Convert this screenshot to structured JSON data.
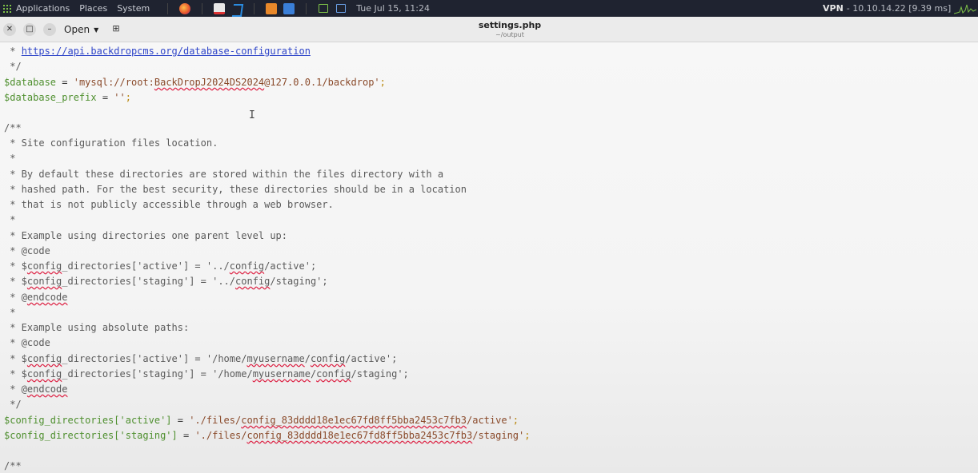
{
  "panel": {
    "menus": [
      "Applications",
      "Places",
      "System"
    ],
    "clock": "Tue Jul 15, 11:24",
    "vpn_label": "VPN",
    "vpn_value": "- 10.10.14.22 [9.39 ms]"
  },
  "window": {
    "open_label": "Open",
    "title": "settings.php",
    "subtitle": "~/output"
  },
  "code": {
    "l1_pre": " * ",
    "l1_url": "https://api.backdropcms.org/database-configuration",
    "l2": " */",
    "l3_var": "$database",
    "l3_eq": " = ",
    "l3_str_a": "'mysql://root:",
    "l3_str_b": "BackDropJ2024DS2024",
    "l3_str_c": "@127.0.0.1/backdrop'",
    "l3_semi": ";",
    "l4_var": "$database_prefix",
    "l4_eq": " = ",
    "l4_str": "''",
    "l4_semi": ";",
    "l6": "/**",
    "l7": " * Site configuration files location.",
    "l8": " *",
    "l9": " * By default these directories are stored within the files directory with a",
    "l10": " * hashed path. For the best security, these directories should be in a location",
    "l11": " * that is not publicly accessible through a web browser.",
    "l12": " *",
    "l13": " * Example using directories one parent level up:",
    "l14": " * @code",
    "l15_a": " * $",
    "l15_b": "config",
    "l15_c": "_directories['active'] = '../",
    "l15_d": "config",
    "l15_e": "/active';",
    "l16_a": " * $",
    "l16_b": "config",
    "l16_c": "_directories['staging'] = '../",
    "l16_d": "config",
    "l16_e": "/staging';",
    "l17_a": " * @",
    "l17_b": "endcode",
    "l18": " *",
    "l19": " * Example using absolute paths:",
    "l20": " * @code",
    "l21_a": " * $",
    "l21_b": "config",
    "l21_c": "_directories['active'] = '/home/",
    "l21_d": "myusername",
    "l21_e": "/",
    "l21_f": "config",
    "l21_g": "/active';",
    "l22_a": " * $",
    "l22_b": "config",
    "l22_c": "_directories['staging'] = '/home/",
    "l22_d": "myusername",
    "l22_e": "/",
    "l22_f": "config",
    "l22_g": "/staging';",
    "l23_a": " * @",
    "l23_b": "endcode",
    "l24": " */",
    "l25_var": "$config_directories['active']",
    "l25_eq": " = ",
    "l25_str_a": "'./files/",
    "l25_str_b": "config_83dddd18e1ec67fd8ff5bba2453c7fb3",
    "l25_str_c": "/active'",
    "l25_semi": ";",
    "l26_var": "$config_directories['staging']",
    "l26_eq": " = ",
    "l26_str_a": "'./files/",
    "l26_str_b": "config_83dddd18e1ec67fd8ff5bba2453c7fb3",
    "l26_str_c": "/staging'",
    "l26_semi": ";",
    "l28": "/**"
  }
}
